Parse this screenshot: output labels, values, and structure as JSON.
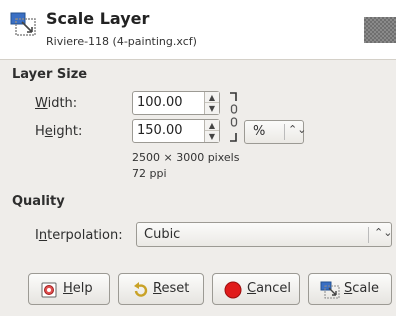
{
  "header": {
    "title": "Scale Layer",
    "subtitle": "Riviere-118 (4-painting.xcf)",
    "icon": "scale-layer-icon",
    "preview": "layer-preview-thumbnail"
  },
  "layer_size": {
    "section_title": "Layer Size",
    "width_label_u": "W",
    "width_label_rest": "idth:",
    "width_value": "100.00",
    "height_label_pre": "H",
    "height_label_u": "e",
    "height_label_rest": "ight:",
    "height_value": "150.00",
    "unit": "%",
    "pixels_info": "2500 × 3000 pixels",
    "ppi_info": "72 ppi"
  },
  "quality": {
    "section_title": "Quality",
    "interp_label_pre": "I",
    "interp_label_u": "n",
    "interp_label_rest": "terpolation:",
    "interpolation": "Cubic"
  },
  "buttons": {
    "help_u": "H",
    "help_rest": "elp",
    "reset_u": "R",
    "reset_rest": "eset",
    "cancel_u": "C",
    "cancel_rest": "ancel",
    "scale_u": "S",
    "scale_rest": "cale"
  },
  "colors": {
    "background": "#efedea",
    "header_bg": "#ffffff",
    "cancel_icon": "#e01b1b"
  }
}
